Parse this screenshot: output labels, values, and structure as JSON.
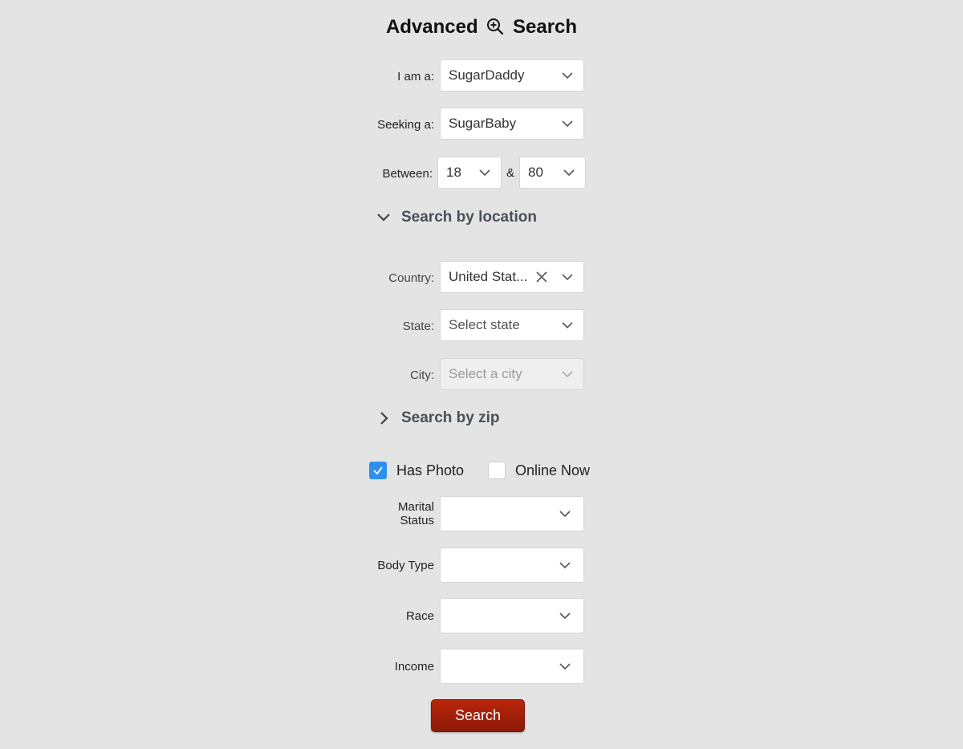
{
  "header": {
    "title_left": "Advanced",
    "title_right": "Search",
    "icon": "zoom-in-icon"
  },
  "fields": {
    "iam": {
      "label": "I am a:",
      "value": "SugarDaddy"
    },
    "seeking": {
      "label": "Seeking a:",
      "value": "SugarBaby"
    },
    "between": {
      "label": "Between:",
      "min": "18",
      "separator": "&",
      "max": "80"
    }
  },
  "location": {
    "section_label": "Search by location",
    "expanded": true,
    "country": {
      "label": "Country:",
      "value": "United Stat..."
    },
    "state": {
      "label": "State:",
      "placeholder": "Select state"
    },
    "city": {
      "label": "City:",
      "placeholder": "Select a city",
      "disabled": true
    }
  },
  "zip": {
    "section_label": "Search by zip",
    "expanded": false
  },
  "filters": {
    "has_photo": {
      "label": "Has Photo",
      "checked": true
    },
    "online_now": {
      "label": "Online Now",
      "checked": false
    }
  },
  "details": {
    "marital_label_1": "Marital",
    "marital_label_2": "Status",
    "marital_value": "",
    "body_type_label": "Body Type",
    "body_type_value": "",
    "race_label": "Race",
    "race_value": "",
    "income_label": "Income",
    "income_value": ""
  },
  "actions": {
    "search_label": "Search"
  },
  "colors": {
    "accent": "#2e8ff0",
    "search_button": "#a1200a",
    "background": "#e4e4e4"
  }
}
